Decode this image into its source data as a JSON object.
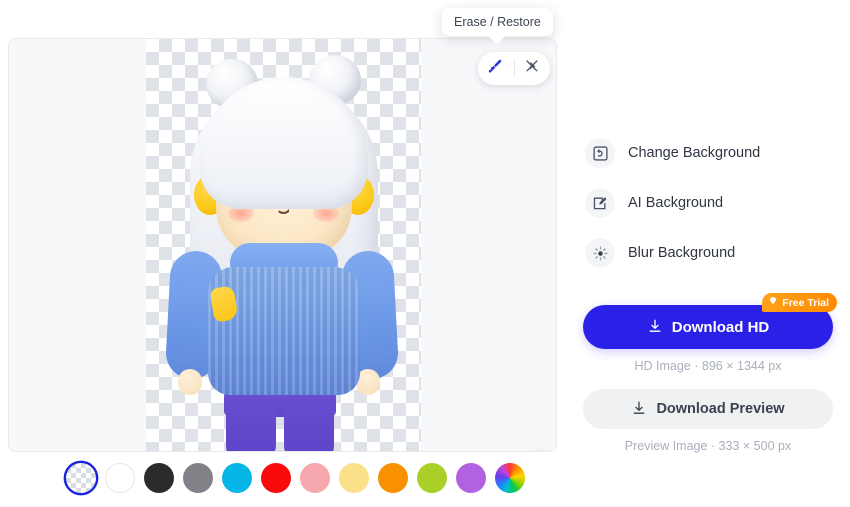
{
  "editor": {
    "tooltip": {
      "text": "Erase / Restore"
    },
    "tools": [
      {
        "name": "brush-tool",
        "icon": "brush-icon",
        "selected": true
      },
      {
        "name": "magic-erase-tool",
        "icon": "magic-wand-icon",
        "selected": false
      }
    ],
    "compare_button": {
      "icon": "compare-split-icon"
    },
    "swatches": [
      {
        "name": "transparent",
        "color": "transparent",
        "selected": true
      },
      {
        "name": "white",
        "color": "#ffffff",
        "selected": false
      },
      {
        "name": "black",
        "color": "#2b2b2b",
        "selected": false
      },
      {
        "name": "gray",
        "color": "#808287",
        "selected": false
      },
      {
        "name": "cyan",
        "color": "#04b6e8",
        "selected": false
      },
      {
        "name": "red",
        "color": "#fa0a0a",
        "selected": false
      },
      {
        "name": "pink",
        "color": "#f7a8ae",
        "selected": false
      },
      {
        "name": "yellow",
        "color": "#fbe08a",
        "selected": false
      },
      {
        "name": "orange",
        "color": "#f99000",
        "selected": false
      },
      {
        "name": "yellow-green",
        "color": "#a9cf28",
        "selected": false
      },
      {
        "name": "purple",
        "color": "#b262e0",
        "selected": false
      },
      {
        "name": "color-picker",
        "color": "rainbow",
        "selected": false
      }
    ]
  },
  "actions": {
    "background_options": [
      {
        "icon": "change-background-icon",
        "label": "Change Background"
      },
      {
        "icon": "ai-background-icon",
        "label": "AI Background"
      },
      {
        "icon": "blur-background-icon",
        "label": "Blur Background"
      }
    ],
    "download_hd": {
      "label": "Download HD",
      "badge": "Free Trial",
      "badge_icon": "gem-icon",
      "icon": "download-icon",
      "caption": "HD Image · 896 × 1344 px",
      "accent": "#2a20e8",
      "badge_accent": "#ff8a00"
    },
    "download_preview": {
      "label": "Download Preview",
      "icon": "download-icon",
      "caption": "Preview Image · 333 × 500 px"
    }
  }
}
